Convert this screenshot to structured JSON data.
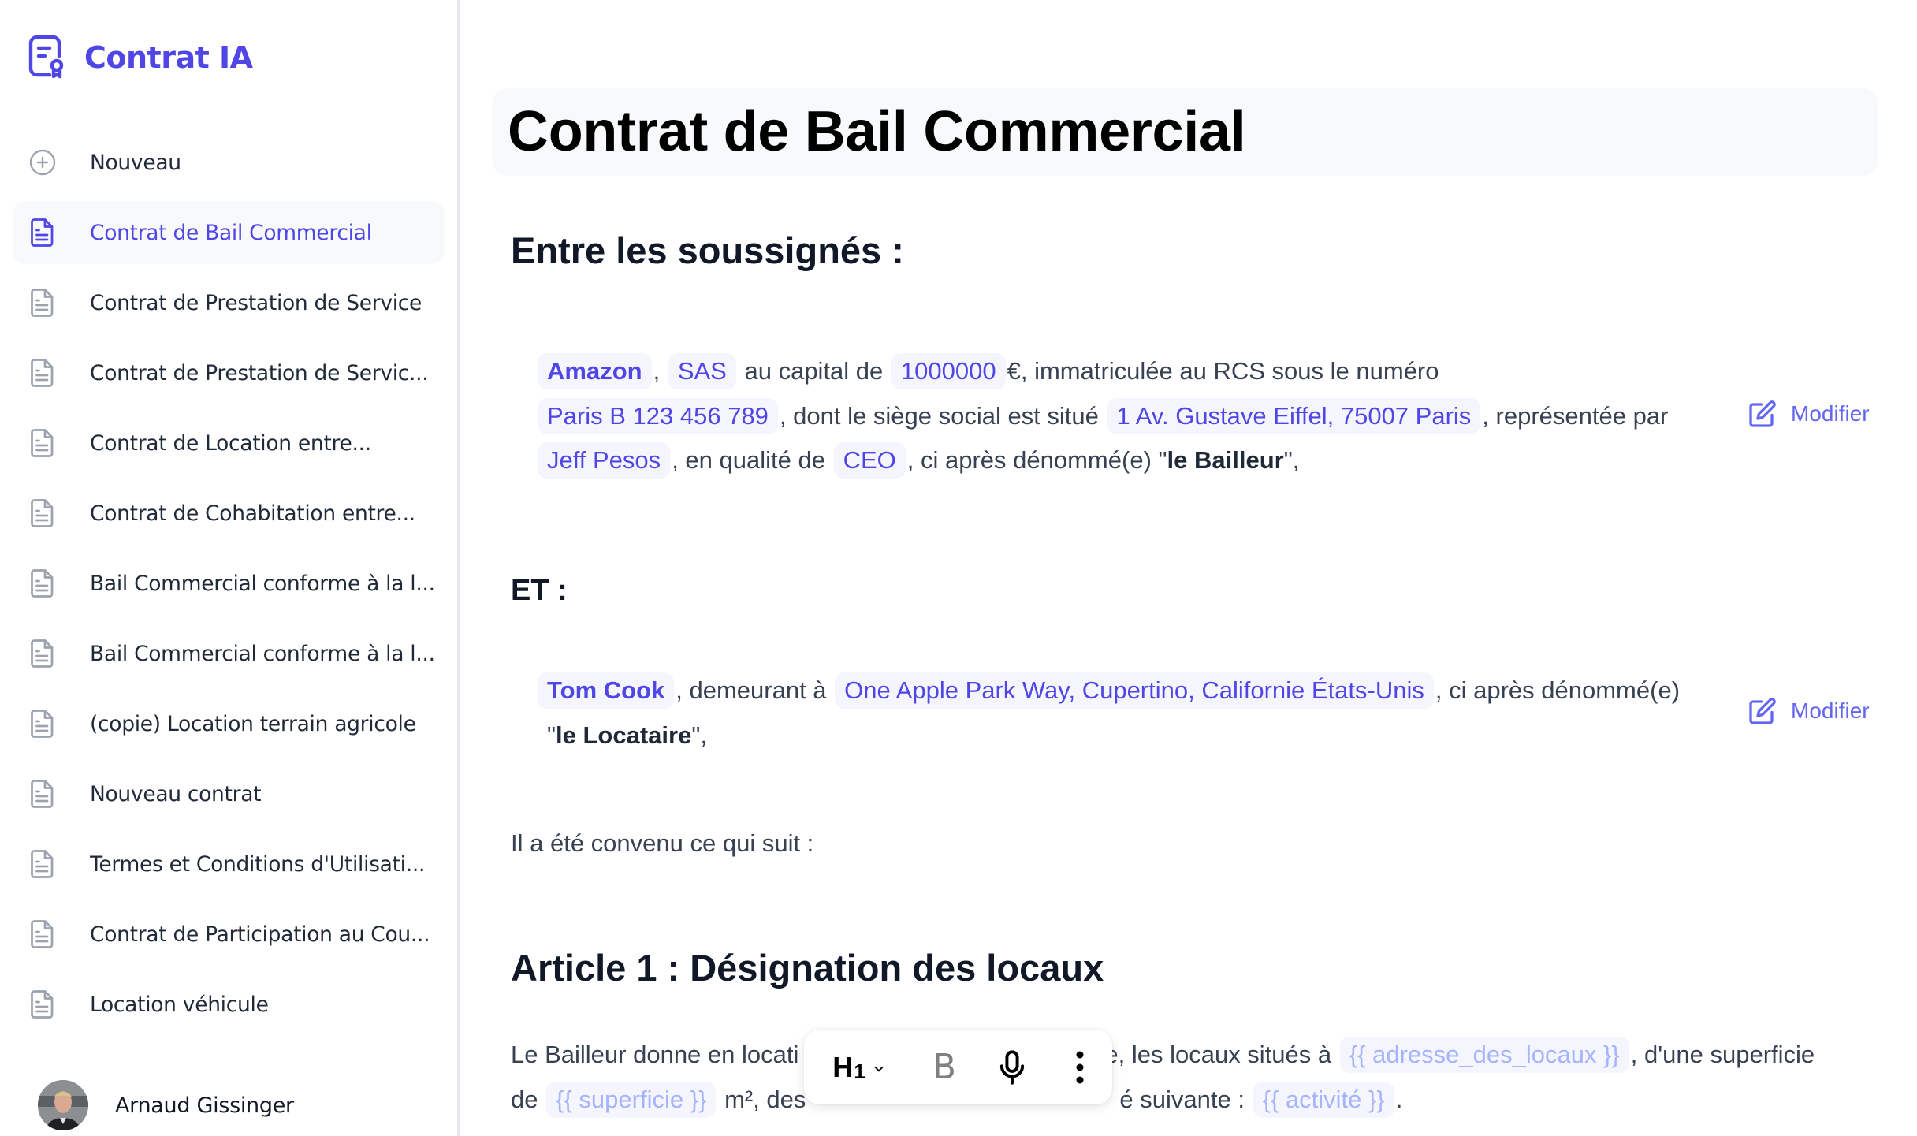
{
  "app": {
    "name": "Contrat IA",
    "brand_color": "#4f46e5"
  },
  "sidebar": {
    "new_item": {
      "label": "Nouveau",
      "icon": "plus-circle-icon"
    },
    "items": [
      {
        "label": "Contrat de Bail Commercial",
        "icon": "document-icon",
        "active": true
      },
      {
        "label": "Contrat de Prestation de Service",
        "icon": "document-icon"
      },
      {
        "label": "Contrat de Prestation de Servic...",
        "icon": "document-icon"
      },
      {
        "label": "Contrat de Location entre...",
        "icon": "document-icon"
      },
      {
        "label": "Contrat de Cohabitation entre...",
        "icon": "document-icon"
      },
      {
        "label": "Bail Commercial conforme à la l...",
        "icon": "document-icon"
      },
      {
        "label": "Bail Commercial conforme à la l...",
        "icon": "document-icon"
      },
      {
        "label": "(copie) Location terrain agricole",
        "icon": "document-icon"
      },
      {
        "label": "Nouveau contrat",
        "icon": "document-icon"
      },
      {
        "label": "Termes et Conditions d'Utilisati...",
        "icon": "document-icon"
      },
      {
        "label": "Contrat de Participation au Cou...",
        "icon": "document-icon"
      },
      {
        "label": "Location véhicule",
        "icon": "document-icon"
      }
    ],
    "user": {
      "name": "Arnaud Gissinger"
    }
  },
  "document": {
    "title": "Contrat de Bail Commercial",
    "section_parties": "Entre les soussignés :",
    "bailleur": {
      "company": "Amazon",
      "sep1": ",",
      "legal_form": "SAS",
      "t_capital": "au capital de",
      "capital": "1000000",
      "t_rcs": "€, immatriculée au RCS sous le numéro",
      "rcs": "Paris B 123 456 789",
      "t_siege": ", dont le siège social est situé",
      "address": "1 Av. Gustave Eiffel, 75007 Paris",
      "t_rep": ", représentée par",
      "representative": "Jeff Pesos",
      "t_qualite": ", en qualité de",
      "role": "CEO",
      "t_denom": ", ci après dénommé(e) \"",
      "denomination": "le Bailleur",
      "t_end": "\","
    },
    "et_label": "ET :",
    "locataire": {
      "name": "Tom Cook",
      "t_demeurant": ", demeurant à",
      "address": "One Apple Park Way, Cupertino, Californie États-Unis",
      "t_denom": ", ci après dénommé(e)",
      "t_quote_open": "\"",
      "denomination": "le Locataire",
      "t_end": "\","
    },
    "modifier_label": "Modifier",
    "intro": "Il a été convenu ce qui suit :",
    "article1": {
      "title": "Article 1 : Désignation des locaux",
      "t1": "Le Bailleur donne en locati",
      "t2": "e, les locaux situés à",
      "placeholder_address": "{{ adresse_des_locaux }}",
      "t3": ", d'une superficie",
      "t4": "de",
      "placeholder_surface": "{{ superficie }}",
      "t5": "m², des",
      "t6": "é suivante :",
      "placeholder_activity": "{{ activité }}",
      "t7": "."
    }
  },
  "toolbar": {
    "heading_label": "H",
    "heading_level": "1",
    "bold_label": "B",
    "icons": [
      "heading-dropdown-icon",
      "bold-icon",
      "microphone-icon",
      "more-vertical-icon"
    ]
  }
}
